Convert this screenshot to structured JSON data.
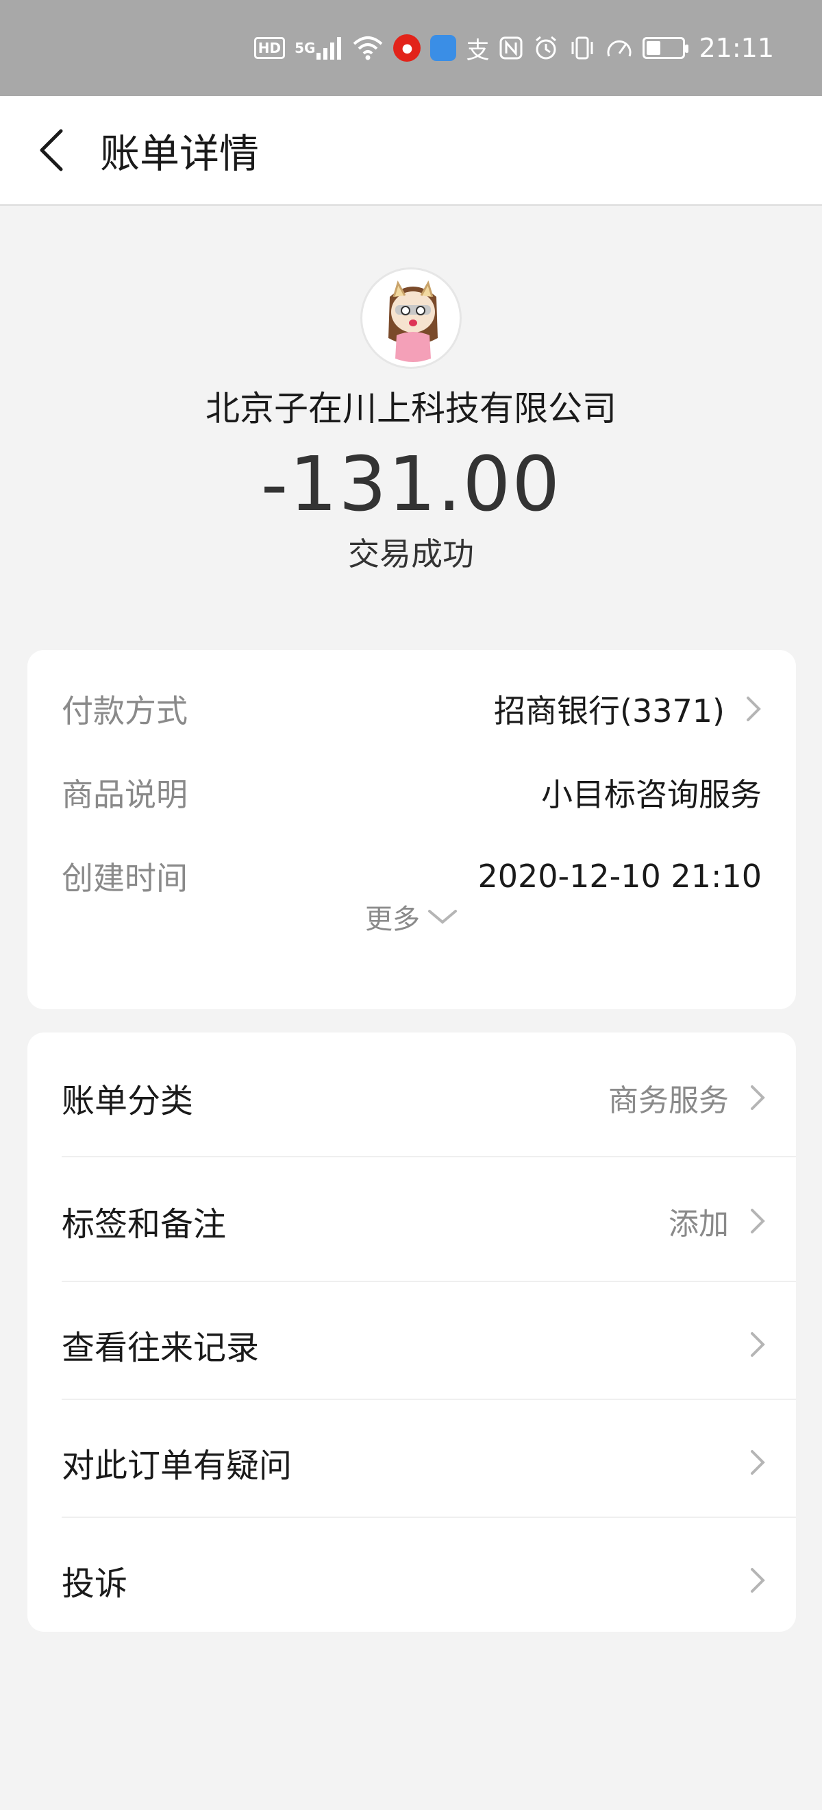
{
  "status_bar": {
    "hd": "HD",
    "network": "5G",
    "time": "21:11",
    "icons": [
      "hd-icon",
      "signal-icon",
      "wifi-icon",
      "app-red-icon",
      "app-blue-icon",
      "alipay-icon",
      "nfc-icon",
      "alarm-icon",
      "vibrate-icon",
      "speed-icon",
      "battery-icon"
    ],
    "battery_level": 0.35
  },
  "header": {
    "title": "账单详情"
  },
  "summary": {
    "merchant": "北京子在川上科技有限公司",
    "amount": "-131.00",
    "status": "交易成功"
  },
  "details": {
    "rows": [
      {
        "label": "付款方式",
        "value": "招商银行(3371)"
      },
      {
        "label": "商品说明",
        "value": "小目标咨询服务"
      },
      {
        "label": "创建时间",
        "value": "2020-12-10 21:10"
      }
    ],
    "more": "更多"
  },
  "actions": [
    {
      "label": "账单分类",
      "value": "商务服务"
    },
    {
      "label": "标签和备注",
      "value": "添加"
    },
    {
      "label": "查看往来记录",
      "value": ""
    },
    {
      "label": "对此订单有疑问",
      "value": ""
    },
    {
      "label": "投诉",
      "value": ""
    }
  ],
  "colors": {
    "status_bar": "#a8a8a8",
    "background": "#f3f3f3",
    "secondary_text": "#8a8a8a"
  }
}
